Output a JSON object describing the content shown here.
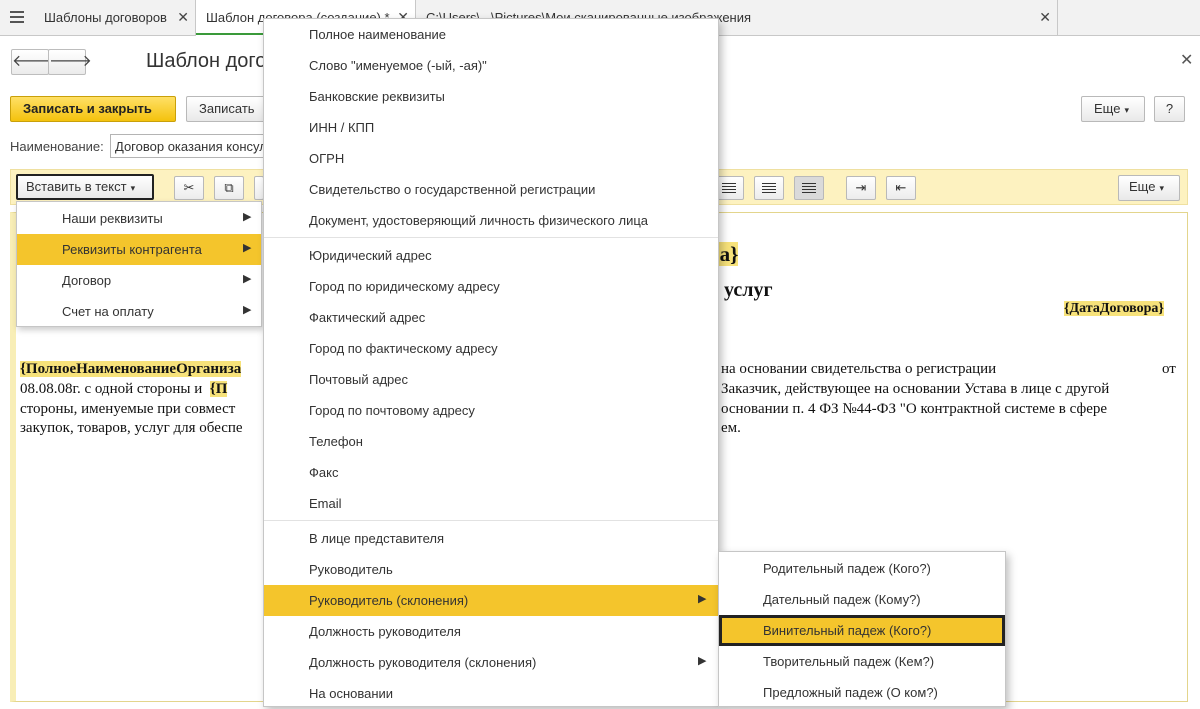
{
  "tabs": [
    {
      "label": "Шаблоны договоров",
      "close": "✕"
    },
    {
      "label": "Шаблон договора (создание) *",
      "close": "✕"
    },
    {
      "label": "C:\\Users\\...\\Pictures\\Мои сканированные изображения",
      "close": "✕"
    }
  ],
  "form": {
    "back_icon": "🡐",
    "forward_icon": "🡒",
    "title": "Шаблон договора",
    "close_icon": "✕",
    "save_close_label": "Записать и закрыть",
    "save_label": "Записать",
    "more_label": "Еще",
    "help_label": "?",
    "name_label": "Наименование:",
    "name_value": "Договор оказания консультационных услуг"
  },
  "toolbar": {
    "insert_label": "Вставить в текст",
    "more_label": "Еще"
  },
  "insert_menu": [
    {
      "label": "Наши реквизиты",
      "chevron": "▶"
    },
    {
      "label": "Реквизиты контрагента",
      "chevron": "▶"
    },
    {
      "label": "Договор",
      "chevron": "▶"
    },
    {
      "label": "Счет на оплату",
      "chevron": "▶"
    }
  ],
  "requisites_menu": [
    {
      "label": "Полное наименование"
    },
    {
      "label": "Слово \"именуемое (-ый, -ая)\""
    },
    {
      "label": "Банковские реквизиты"
    },
    {
      "label": "ИНН / КПП"
    },
    {
      "label": "ОГРН"
    },
    {
      "label": "Свидетельство о государственной регистрации"
    },
    {
      "label": "Документ, удостоверяющий личность физического лица"
    },
    {
      "label": "Юридический адрес"
    },
    {
      "label": "Город по юридическому адресу"
    },
    {
      "label": "Фактический адрес"
    },
    {
      "label": "Город по фактическому адресу"
    },
    {
      "label": "Почтовый адрес"
    },
    {
      "label": "Город по почтовому адресу"
    },
    {
      "label": "Телефон"
    },
    {
      "label": "Факс"
    },
    {
      "label": "Email"
    },
    {
      "label": "В лице представителя"
    },
    {
      "label": "Руководитель"
    },
    {
      "label": "Руководитель (склонения)",
      "chevron": "▶"
    },
    {
      "label": "Должность руководителя"
    },
    {
      "label": "Должность руководителя (склонения)",
      "chevron": "▶"
    },
    {
      "label": "На основании"
    }
  ],
  "case_menu": [
    {
      "label": "Родительный падеж (Кого?)"
    },
    {
      "label": "Дательный падеж (Кому?)"
    },
    {
      "label": "Винительный падеж (Кого?)"
    },
    {
      "label": "Творительный падеж (Кем?)"
    },
    {
      "label": "Предложный падеж (О ком?)"
    }
  ],
  "document": {
    "heading_field": "ра}",
    "heading_text": "услуг",
    "date_field": "{ДатаДоговора}",
    "l1_field": "{ПолноеНаименованиеОрганиза",
    "l1_right": "на основании свидетельства о регистрации",
    "l1_end": "от",
    "l2_left": "08.08.08г. с одной стороны и",
    "l2_field": "{П",
    "l2_right": "Заказчик, действующее на основании Устава в лице  с другой",
    "l3_left": "стороны, именуемые при совмест",
    "l3_right": "основании п. 4 ФЗ №44-ФЗ \"О контрактной системе в сфере",
    "l4_left": "закупок, товаров, услуг для обеспе",
    "l4_right": "ем."
  },
  "colors": {
    "accent_yellow": "#f4c52c",
    "toolbar_bg": "#fdf2c0",
    "tab_active_line": "#3a9a3a"
  },
  "icons": {
    "menu": "hamburger-icon",
    "cut": "scissors-icon",
    "copy": "copy-icon",
    "align_center": "align-center-icon",
    "align_right": "align-right-icon",
    "align_justify": "align-justify-icon",
    "indent": "indent-increase-icon",
    "outdent": "indent-decrease-icon"
  }
}
